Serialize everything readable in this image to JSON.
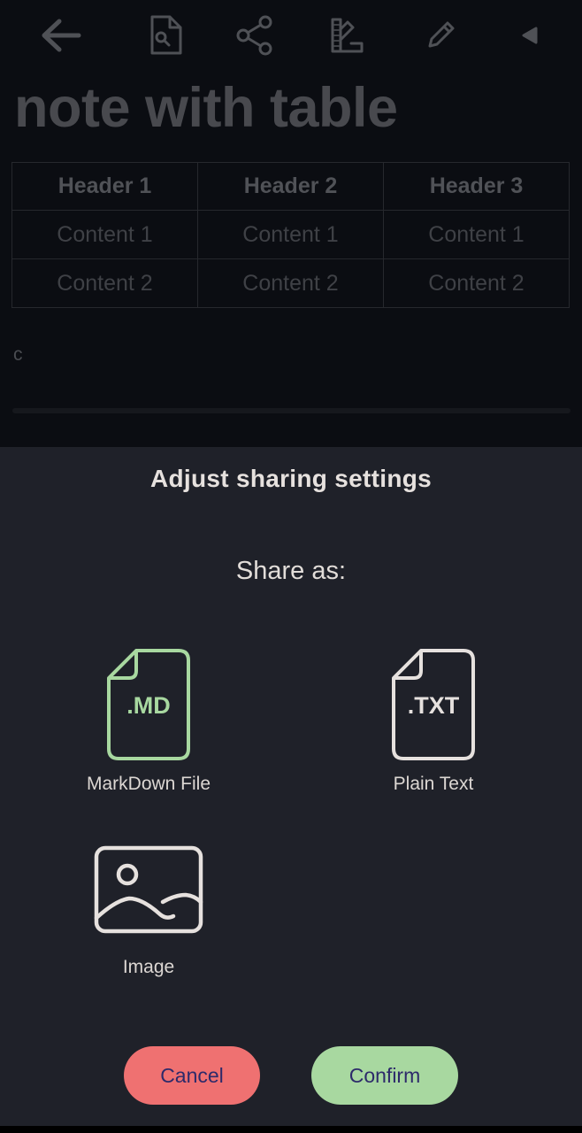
{
  "toolbar": {
    "icons": [
      "back-arrow-icon",
      "document-search-icon",
      "share-icon",
      "palette-icon",
      "pencil-icon",
      "play-left-icon"
    ]
  },
  "note": {
    "title": "note with table",
    "table": {
      "headers": [
        "Header 1",
        "Header 2",
        "Header 3"
      ],
      "rows": [
        [
          "Content 1",
          "Content 1",
          "Content 1"
        ],
        [
          "Content 2",
          "Content 2",
          "Content 2"
        ]
      ]
    },
    "body_text": "c"
  },
  "sheet": {
    "title": "Adjust sharing settings",
    "subtitle": "Share as:",
    "options": [
      {
        "label": "MarkDown File",
        "badge": ".MD",
        "icon": "markdown-file-icon",
        "selected": true
      },
      {
        "label": "Plain Text",
        "badge": ".TXT",
        "icon": "text-file-icon",
        "selected": false
      },
      {
        "label": "Image",
        "icon": "image-icon",
        "selected": false
      }
    ],
    "cancel_label": "Cancel",
    "confirm_label": "Confirm"
  },
  "colors": {
    "selected": "#a8d8a0",
    "unselected": "#e6e1de",
    "cancel": "#ef7171",
    "confirm": "#a8d8a0",
    "sheet_bg": "#1f2129"
  }
}
